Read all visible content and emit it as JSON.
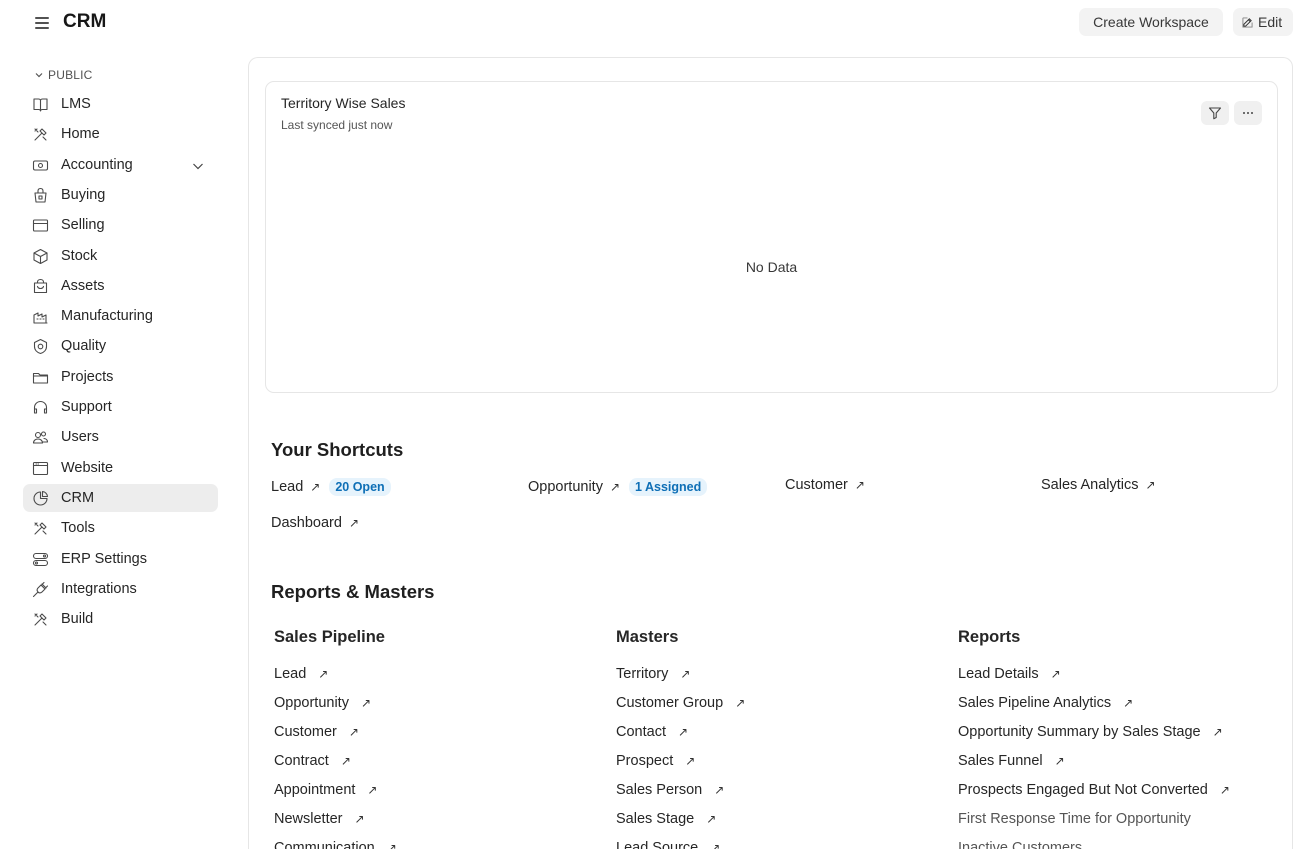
{
  "header": {
    "title": "CRM",
    "create_workspace": "Create Workspace",
    "edit": "Edit"
  },
  "sidebar": {
    "section": "PUBLIC",
    "items": [
      {
        "label": "LMS",
        "icon": "book-icon"
      },
      {
        "label": "Home",
        "icon": "tools-icon"
      },
      {
        "label": "Accounting",
        "icon": "money-icon"
      },
      {
        "label": "Buying",
        "icon": "basket-icon"
      },
      {
        "label": "Selling",
        "icon": "card-icon"
      },
      {
        "label": "Stock",
        "icon": "box-icon"
      },
      {
        "label": "Assets",
        "icon": "bag-icon"
      },
      {
        "label": "Manufacturing",
        "icon": "factory-icon"
      },
      {
        "label": "Quality",
        "icon": "shield-icon"
      },
      {
        "label": "Projects",
        "icon": "folder-icon"
      },
      {
        "label": "Support",
        "icon": "headset-icon"
      },
      {
        "label": "Users",
        "icon": "users-icon"
      },
      {
        "label": "Website",
        "icon": "browser-icon"
      },
      {
        "label": "CRM",
        "icon": "crm-icon",
        "active": true
      },
      {
        "label": "Tools",
        "icon": "tools-icon"
      },
      {
        "label": "ERP Settings",
        "icon": "settings-icon"
      },
      {
        "label": "Integrations",
        "icon": "plug-icon"
      },
      {
        "label": "Build",
        "icon": "tools-icon"
      }
    ]
  },
  "chart": {
    "title": "Territory Wise Sales",
    "subtitle": "Last synced just now",
    "empty": "No Data"
  },
  "shortcuts": {
    "heading": "Your Shortcuts",
    "items": [
      {
        "label": "Lead",
        "badge": "20 Open"
      },
      {
        "label": "Opportunity",
        "badge": "1 Assigned"
      },
      {
        "label": "Customer"
      },
      {
        "label": "Sales Analytics"
      },
      {
        "label": "Dashboard"
      }
    ]
  },
  "reports": {
    "heading": "Reports & Masters",
    "columns": [
      {
        "title": "Sales Pipeline",
        "links": [
          "Lead",
          "Opportunity",
          "Customer",
          "Contract",
          "Appointment",
          "Newsletter",
          "Communication"
        ]
      },
      {
        "title": "Masters",
        "links": [
          "Territory",
          "Customer Group",
          "Contact",
          "Prospect",
          "Sales Person",
          "Sales Stage",
          "Lead Source"
        ]
      },
      {
        "title": "Reports",
        "links": [
          "Lead Details",
          "Sales Pipeline Analytics",
          "Opportunity Summary by Sales Stage",
          "Sales Funnel",
          "Prospects Engaged But Not Converted",
          "First Response Time for Opportunity",
          "Inactive Customers"
        ]
      }
    ]
  }
}
